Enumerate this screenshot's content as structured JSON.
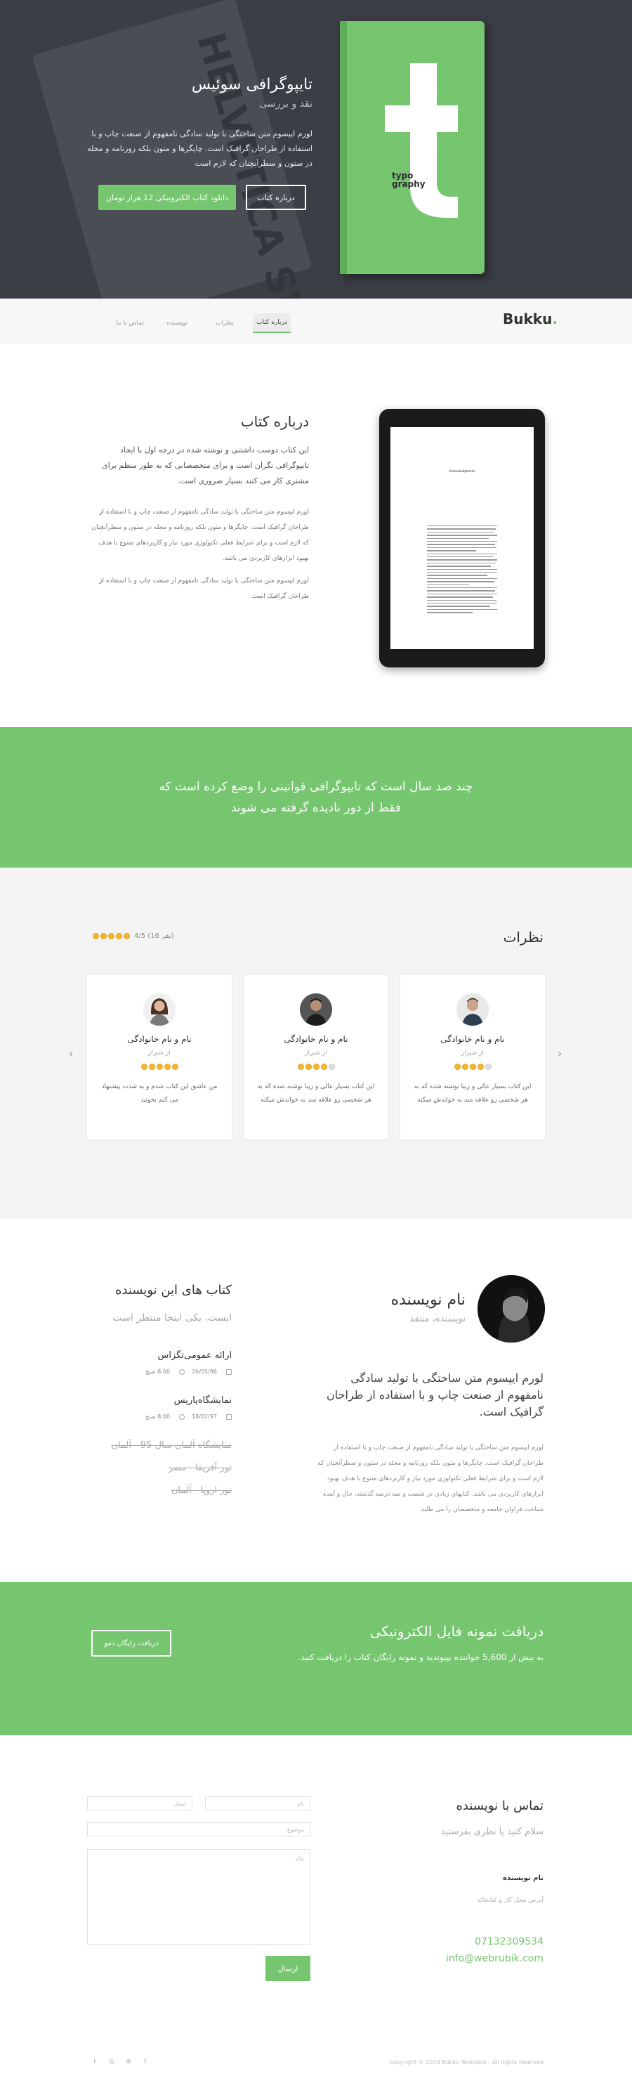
{
  "hero": {
    "title": "تایپوگرافی سوئیس",
    "subtitle": "نقد و بررسی",
    "description": "لورم ایپسوم متن ساختگی با تولید سادگی نامفهوم از صنعت چاپ و با استفاده از طراحان گرافیک است. چاپگرها و متون بلکه روزنامه و مجله در ستون و سطرآنچنان که لازم است",
    "about_button": "درباره کتاب",
    "download_button": "دانلود کتاب الکترونیکی 12 هزار تومان",
    "book_cover_small_text_1": "typo",
    "book_cover_small_text_2": "graphy",
    "background_book_text": "HELVETICA SWISS STYLE"
  },
  "nav": {
    "logo": "Bukku",
    "logo_dot": ".",
    "items": [
      "درباره کتاب",
      "نظرات",
      "نویسنده",
      "تماس با ما"
    ]
  },
  "about": {
    "title": "درباره کتاب",
    "lead": "این کتاب دوست داشتنی و نوشته شده در درجه اول با ایجاد تایپوگرافی نگران است و برای متخصصانی که به طور منظم برای مشتری کار می کنند بسیار ضروری است.",
    "p1": "لورم ایپسوم متن ساختگی با تولید سادگی نامفهوم از صنعت چاپ و با استفاده از طراحان گرافیک است. چاپگرها و متون بلکه روزنامه و مجله در ستون و سطرآنچنان که لازم است و برای شرایط فعلی تکنولوژی مورد نیاز و کاربردهای متنوع با هدف بهبود ابزارهای کاربردی می باشد.",
    "p2": "لورم ایپسوم متن ساختگی با تولید سادگی نامفهوم از صنعت چاپ و با استفاده از طراحان گرافیک است.",
    "tablet_page_title": "Acknowledgments"
  },
  "quote": {
    "line1": "چند صد سال است که تایپوگرافی قوانینی را وضع کرده است که",
    "line2": "فقط از دور نادیده گرفته می شوند"
  },
  "reviews": {
    "title": "نظرات",
    "rating_text": "4/5 (16 نفر)",
    "rating_value": 4.5,
    "cards": [
      {
        "name": "نام و نام خانوادگی",
        "city": "از شیراز",
        "stars": 4,
        "text": "این کتاب بسیار عالی و زیبا نوشته شده که به هر شخصی رو علاقه مند به خواندش میکنه"
      },
      {
        "name": "نام و نام خانوادگی",
        "city": "از شیراز",
        "stars": 4,
        "text": "این کتاب بسیار عالی و زیبا نوشته شده که به هر شخصی رو علاقه مند به خواندش میکنه"
      },
      {
        "name": "نام و نام خانوادگی",
        "city": "از شیراز",
        "stars": 5,
        "text": "من عاشق این کتاب شدم و به شدت پیشنهاد می کنم بخونید"
      }
    ]
  },
  "author": {
    "name": "نام نویسنده",
    "role": "نویسنده، منتقد",
    "lead": "لورم ایپسوم متن ساختگی با تولید سادگی نامفهوم از صنعت چاپ و با استفاده از طراحان گرافیک است.",
    "bio": "لورم ایپسوم متن ساختگی با تولید سادگی نامفهوم از صنعت چاپ و با استفاده از طراحان گرافیک است. چاپگرها و متون بلکه روزنامه و مجله در ستون و سطرآنچنان که لازم است و برای شرایط فعلی تکنولوژی مورد نیاز و کاربردهای متنوع با هدف بهبود ابزارهای کاربردی می باشد. کتابهای زیادی در شصت و سه درصد گذشته، حال و آینده شناخت فراوان جامعه و متخصصان را می طلبد"
  },
  "books": {
    "title": "کتاب های این نویسنده",
    "subtitle": "ایست، یکی اینجا منتظر است",
    "items": [
      {
        "title": "ارائه عمومی‌تگزاس",
        "date": "26/05/96",
        "time": "8:00 صبح"
      },
      {
        "title": "نمایشگاه‌پاریس",
        "date": "18/02/97",
        "time": "8:00 صبح"
      }
    ],
    "struck": [
      "نمایشگاه آلمان سال 95 - آلمان",
      "تور آفریقا - مصر",
      "تور اروپا - آلمان"
    ]
  },
  "download": {
    "title": "دریافت نمونه فایل الکترونیکی",
    "subtitle": "به بیش از 5,600 خواننده بپیوندید و نمونه رایگان کتاب را دریافت کنید.",
    "button": "دریافت رایگان دمو"
  },
  "contact": {
    "title": "تماس با نویسنده",
    "subtitle": "سلام کنید یا نظری بفرستید",
    "label": "نام نویسنده",
    "address": "آدرس محل کار و کتابخانه",
    "phone": "07132309534",
    "email": "info@webrubik.com",
    "name_placeholder": "نام",
    "email_placeholder": "ایمیل",
    "subject_placeholder": "موضوع",
    "message_placeholder": "پیام",
    "send": "ارسال"
  },
  "footer": {
    "copyright": "Copyright © 2019 Bukku Template - All rights reserved",
    "social": [
      "twitter-icon",
      "instagram-icon",
      "dribbble-icon",
      "facebook-icon"
    ]
  },
  "colors": {
    "accent": "#76c56f",
    "hero_bg": "#3b3e45"
  }
}
